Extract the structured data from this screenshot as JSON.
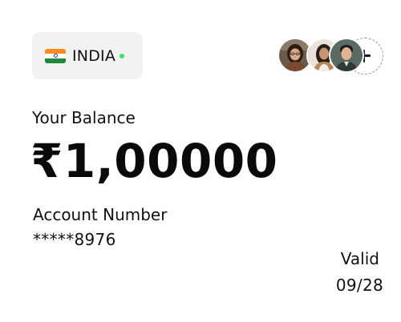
{
  "country": {
    "name": "INDIA",
    "flag_icon": "india-flag-icon",
    "status_color": "#35e06a"
  },
  "members": {
    "avatars": [
      "avatar-woman-1",
      "avatar-woman-2",
      "avatar-man-1"
    ],
    "add_icon": "plus-icon"
  },
  "balance": {
    "label": "Your Balance",
    "amount": "₹1,00000"
  },
  "account": {
    "label": "Account Number",
    "number": "*****8976"
  },
  "validity": {
    "label": "Valid",
    "date": "09/28"
  }
}
